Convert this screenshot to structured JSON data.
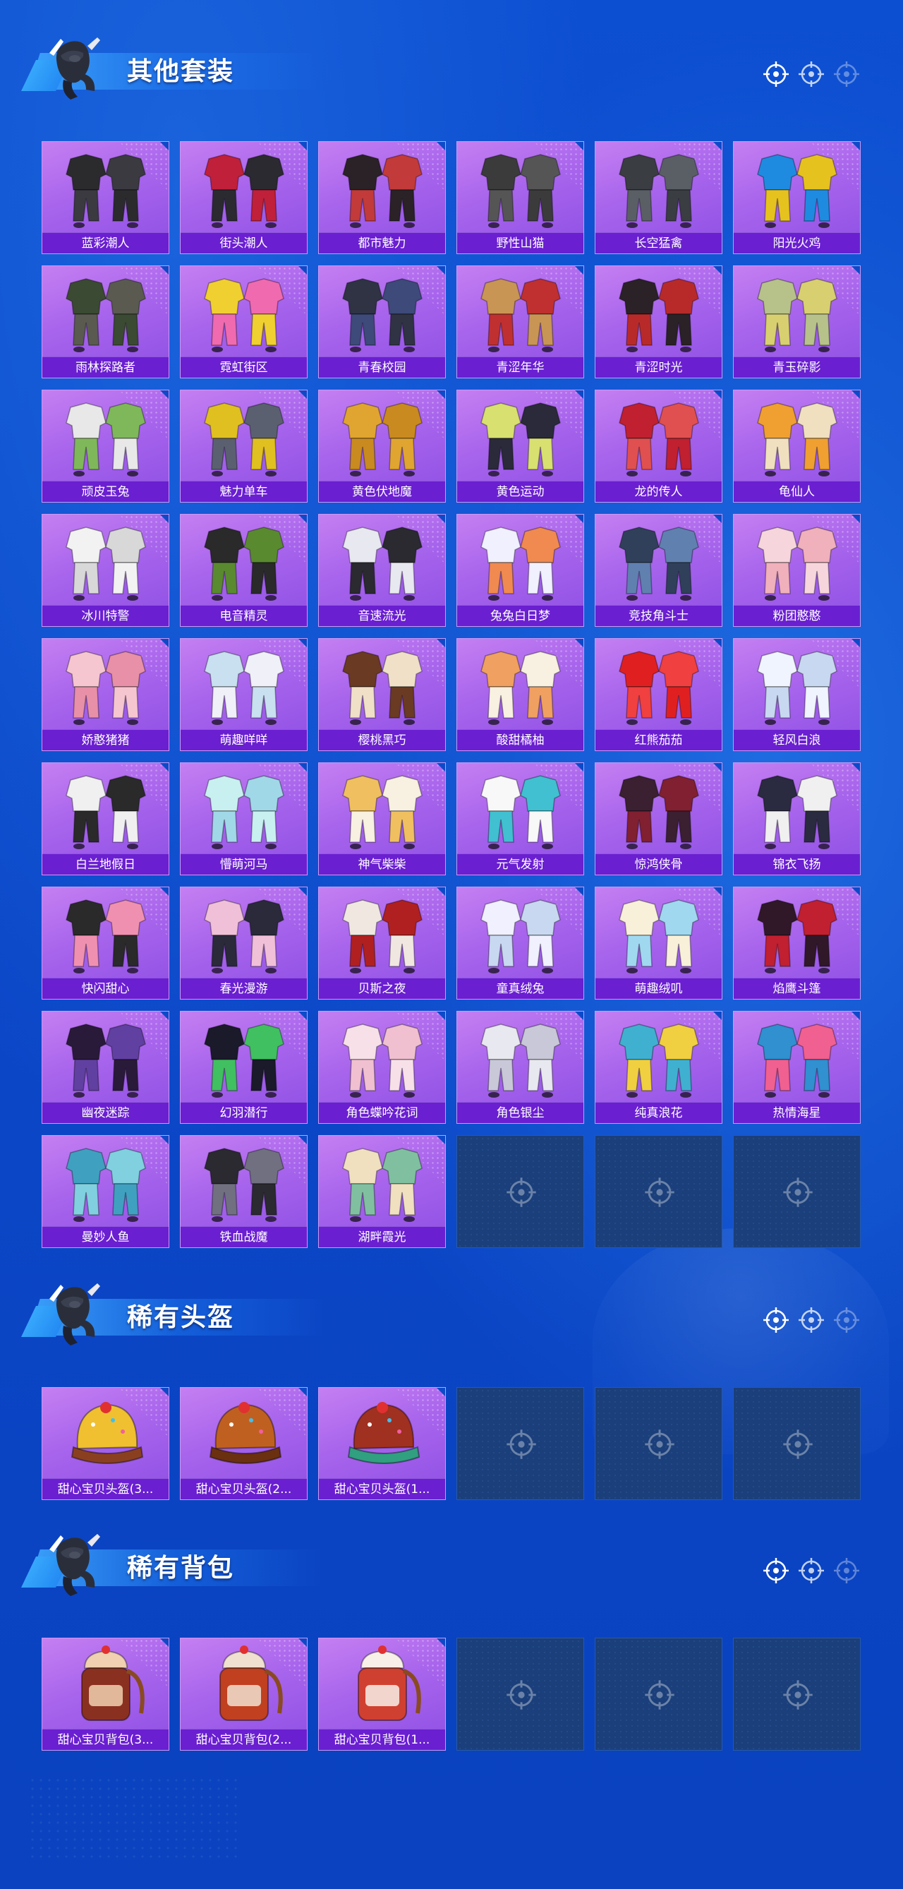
{
  "colors": {
    "background": "#0c4ac8",
    "tile_purple": "#a764ec",
    "label_bar": "#6a1fd1",
    "empty_slot": "#1b3f7a",
    "title_text": "#ffffff"
  },
  "sections": [
    {
      "title": "其他套装",
      "icon": "mascot-icon",
      "items": [
        {
          "label": "蓝彩潮人",
          "art": [
            "#2b2b2e",
            "#3a3a40"
          ]
        },
        {
          "label": "街头潮人",
          "art": [
            "#c0203a",
            "#2a2a30"
          ]
        },
        {
          "label": "都市魅力",
          "art": [
            "#2a2226",
            "#c23a3a"
          ]
        },
        {
          "label": "野性山猫",
          "art": [
            "#3b3b3b",
            "#555555"
          ]
        },
        {
          "label": "长空猛禽",
          "art": [
            "#3a3d42",
            "#5a5f66"
          ]
        },
        {
          "label": "阳光火鸡",
          "art": [
            "#1f8be0",
            "#e6c21f"
          ]
        },
        {
          "label": "雨林探路者",
          "art": [
            "#3b4a32",
            "#5a5a50"
          ]
        },
        {
          "label": "霓虹街区",
          "art": [
            "#f0d030",
            "#f06ab0"
          ]
        },
        {
          "label": "青春校园",
          "art": [
            "#2f3344",
            "#3d4a7a"
          ]
        },
        {
          "label": "青涩年华",
          "art": [
            "#c99555",
            "#c03030"
          ]
        },
        {
          "label": "青涩时光",
          "art": [
            "#2a2226",
            "#b82a2a"
          ]
        },
        {
          "label": "青玉碎影",
          "art": [
            "#b7c28a",
            "#d8d070"
          ]
        },
        {
          "label": "顽皮玉兔",
          "art": [
            "#e8e8e8",
            "#7fb85a"
          ]
        },
        {
          "label": "魅力单车",
          "art": [
            "#e0c020",
            "#5a6070"
          ]
        },
        {
          "label": "黄色伏地魔",
          "art": [
            "#e0a530",
            "#c98a20"
          ]
        },
        {
          "label": "黄色运动",
          "art": [
            "#d8e070",
            "#2a2a3a"
          ]
        },
        {
          "label": "龙的传人",
          "art": [
            "#c02030",
            "#e05050"
          ]
        },
        {
          "label": "龟仙人",
          "art": [
            "#f0a030",
            "#f0e0c0"
          ]
        },
        {
          "label": "冰川特警",
          "art": [
            "#f2f2f2",
            "#d8d8d8"
          ]
        },
        {
          "label": "电音精灵",
          "art": [
            "#2a2a2a",
            "#5a8a30"
          ]
        },
        {
          "label": "音速流光",
          "art": [
            "#e8e8f0",
            "#2a2a30"
          ]
        },
        {
          "label": "兔兔白日梦",
          "art": [
            "#f0f0ff",
            "#f08a50"
          ]
        },
        {
          "label": "竞技角斗士",
          "art": [
            "#30405a",
            "#6080b0"
          ]
        },
        {
          "label": "粉团憨憨",
          "art": [
            "#f6d6dc",
            "#f0b0bc"
          ]
        },
        {
          "label": "娇憨猪猪",
          "art": [
            "#f6c6d0",
            "#e890a8"
          ]
        },
        {
          "label": "萌趣咩咩",
          "art": [
            "#c8e0f0",
            "#f0f0f8"
          ]
        },
        {
          "label": "樱桃黑巧",
          "art": [
            "#6a3a22",
            "#f0e0c8"
          ]
        },
        {
          "label": "酸甜橘柚",
          "art": [
            "#f0a060",
            "#f8f0e0"
          ]
        },
        {
          "label": "红熊茄茄",
          "art": [
            "#e02020",
            "#f04040"
          ]
        },
        {
          "label": "轻风白浪",
          "art": [
            "#f0f4ff",
            "#c8d8f0"
          ]
        },
        {
          "label": "白兰地假日",
          "art": [
            "#f0f0f0",
            "#2a2a2a"
          ]
        },
        {
          "label": "懵萌河马",
          "art": [
            "#c8f0f0",
            "#a0d8e8"
          ]
        },
        {
          "label": "神气柴柴",
          "art": [
            "#f0c060",
            "#f8f0e0"
          ]
        },
        {
          "label": "元气发射",
          "art": [
            "#f8f8f8",
            "#40c0d0"
          ]
        },
        {
          "label": "惊鸿侠骨",
          "art": [
            "#3a2030",
            "#802030"
          ]
        },
        {
          "label": "锦衣飞扬",
          "art": [
            "#2a2a40",
            "#f0f0f0"
          ]
        },
        {
          "label": "快闪甜心",
          "art": [
            "#2a2a2a",
            "#f090b0"
          ]
        },
        {
          "label": "春光漫游",
          "art": [
            "#f0c0d8",
            "#2a2a3a"
          ]
        },
        {
          "label": "贝斯之夜",
          "art": [
            "#f0e8e0",
            "#b02020"
          ]
        },
        {
          "label": "童真绒兔",
          "art": [
            "#f0f0ff",
            "#c8d8f0"
          ]
        },
        {
          "label": "萌趣绒叽",
          "art": [
            "#f8f0d8",
            "#a0d8f0"
          ]
        },
        {
          "label": "焰鹰斗篷",
          "art": [
            "#301828",
            "#c02030"
          ]
        },
        {
          "label": "幽夜迷踪",
          "art": [
            "#2a1a3a",
            "#6040a0"
          ]
        },
        {
          "label": "幻羽潜行",
          "art": [
            "#1a1a2a",
            "#40c060"
          ]
        },
        {
          "label": "角色蝶吟花词",
          "art": [
            "#f8e0e8",
            "#f0c0d0"
          ]
        },
        {
          "label": "角色银尘",
          "art": [
            "#e8e8f0",
            "#c8c8d8"
          ]
        },
        {
          "label": "纯真浪花",
          "art": [
            "#40b0d0",
            "#f0d040"
          ]
        },
        {
          "label": "热情海星",
          "art": [
            "#3090d0",
            "#f06090"
          ]
        },
        {
          "label": "曼妙人鱼",
          "art": [
            "#40a0c0",
            "#80d0e0"
          ]
        },
        {
          "label": "铁血战魔",
          "art": [
            "#2a2a30",
            "#707080"
          ]
        },
        {
          "label": "湖畔霞光",
          "art": [
            "#f0e0c0",
            "#80c0a0"
          ]
        }
      ],
      "empty_slots": 3
    },
    {
      "title": "稀有头盔",
      "icon": "mascot-icon",
      "items": [
        {
          "label": "甜心宝贝头盔(3...",
          "art": [
            "#f0c030",
            "#8a4020"
          ]
        },
        {
          "label": "甜心宝贝头盔(2...",
          "art": [
            "#c06020",
            "#6a3010"
          ]
        },
        {
          "label": "甜心宝贝头盔(1...",
          "art": [
            "#a03020",
            "#30a080"
          ]
        }
      ],
      "empty_slots": 3
    },
    {
      "title": "稀有背包",
      "icon": "mascot-icon",
      "items": [
        {
          "label": "甜心宝贝背包(3...",
          "art": [
            "#8a3020",
            "#f0d0b0"
          ]
        },
        {
          "label": "甜心宝贝背包(2...",
          "art": [
            "#c04020",
            "#f0e0d0"
          ]
        },
        {
          "label": "甜心宝贝背包(1...",
          "art": [
            "#d04030",
            "#f8f0e8"
          ]
        }
      ],
      "empty_slots": 3
    }
  ]
}
